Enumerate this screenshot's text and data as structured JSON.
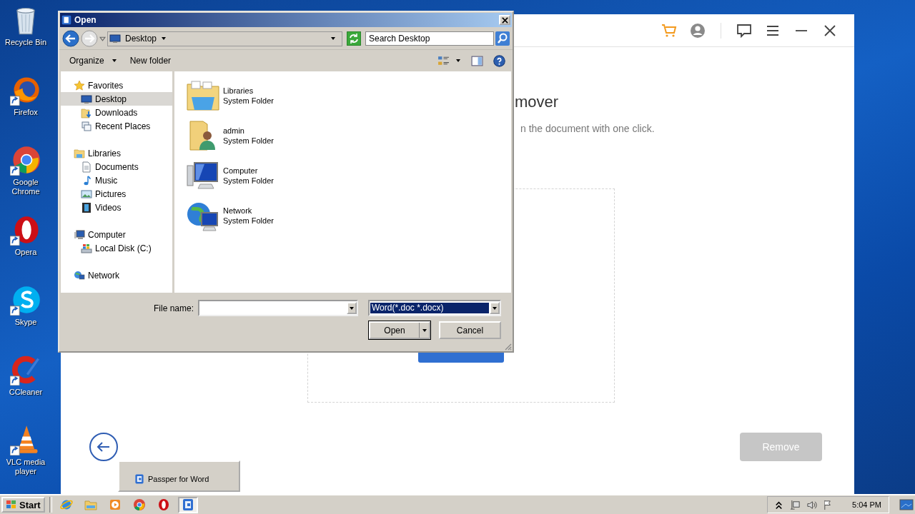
{
  "desktop": {
    "shortcuts": [
      {
        "label": "Recycle Bin",
        "kind": "recycle",
        "shortcut": false
      },
      {
        "label": "Firefox",
        "kind": "firefox",
        "shortcut": true
      },
      {
        "label": "Google Chrome",
        "kind": "chrome",
        "shortcut": true
      },
      {
        "label": "Opera",
        "kind": "opera",
        "shortcut": true
      },
      {
        "label": "Skype",
        "kind": "skype",
        "shortcut": true
      },
      {
        "label": "CCleaner",
        "kind": "ccleaner",
        "shortcut": true
      },
      {
        "label": "VLC media player",
        "kind": "vlc",
        "shortcut": true
      }
    ]
  },
  "app": {
    "title": "mover",
    "subtitle": "n the document with one click.",
    "remove_button": "Remove"
  },
  "dialog": {
    "title": "Open",
    "address": "Desktop",
    "search_placeholder": "Search Desktop",
    "organize": "Organize",
    "new_folder": "New folder",
    "nav_tree": [
      {
        "label": "Favorites",
        "kind": "star",
        "selected": false,
        "children": [
          {
            "label": "Desktop",
            "kind": "desktop",
            "selected": true
          },
          {
            "label": "Downloads",
            "kind": "downloads",
            "selected": false
          },
          {
            "label": "Recent Places",
            "kind": "recent",
            "selected": false
          }
        ]
      },
      {
        "label": "Libraries",
        "kind": "libraries",
        "selected": false,
        "children": [
          {
            "label": "Documents",
            "kind": "documents",
            "selected": false
          },
          {
            "label": "Music",
            "kind": "music",
            "selected": false
          },
          {
            "label": "Pictures",
            "kind": "pictures",
            "selected": false
          },
          {
            "label": "Videos",
            "kind": "videos",
            "selected": false
          }
        ]
      },
      {
        "label": "Computer",
        "kind": "computer",
        "selected": false,
        "children": [
          {
            "label": "Local Disk (C:)",
            "kind": "disk",
            "selected": false
          }
        ]
      },
      {
        "label": "Network",
        "kind": "network",
        "selected": false
      }
    ],
    "items": [
      {
        "name": "Libraries",
        "type": "System Folder",
        "kind": "libraries"
      },
      {
        "name": "admin",
        "type": "System Folder",
        "kind": "user"
      },
      {
        "name": "Computer",
        "type": "System Folder",
        "kind": "computer"
      },
      {
        "name": "Network",
        "type": "System Folder",
        "kind": "network"
      }
    ],
    "file_name_label": "File name:",
    "file_type": "Word(*.doc *.docx)",
    "open_button": "Open",
    "cancel_button": "Cancel"
  },
  "thumbnail": {
    "title": "Passper for Word"
  },
  "taskbar": {
    "start": "Start",
    "apps": [
      {
        "kind": "ie",
        "active": false
      },
      {
        "kind": "explorer",
        "active": false
      },
      {
        "kind": "media",
        "active": false
      },
      {
        "kind": "chrome",
        "active": false
      },
      {
        "kind": "opera",
        "active": false
      },
      {
        "kind": "passper",
        "active": true
      }
    ],
    "clock": "5:04 PM"
  }
}
